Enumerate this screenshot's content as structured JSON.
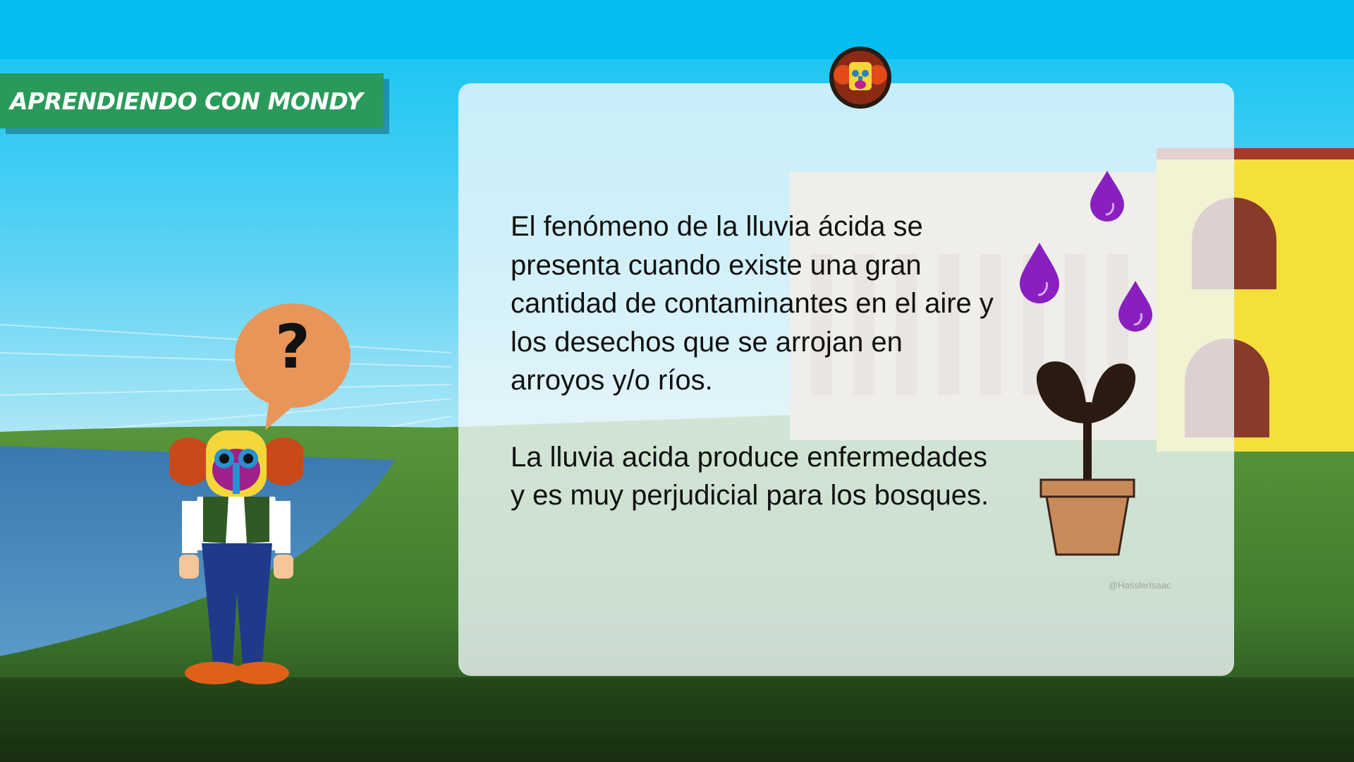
{
  "banner": {
    "title": "APRENDIENDO CON MONDY"
  },
  "card": {
    "paragraphs": [
      "El fenómeno de la lluvia ácida se presenta cuando existe una gran cantidad de contaminantes en el aire y los desechos que se arrojan en arroyos y/o ríos.",
      "La lluvia acida produce enfermedades y es muy perjudicial para los bosques."
    ],
    "watermark": "@HasslerIsaac"
  },
  "bubble": {
    "symbol": "?"
  },
  "icons": {
    "logo": "mondy-logo-icon",
    "raindrop": "raindrop-icon",
    "plant": "potted-sprout-icon",
    "character": "mondy-character"
  },
  "colors": {
    "banner": "#2a9a5a",
    "raindrop": "#8a1fc0",
    "bubble": "#e8955a",
    "pot": "#c98a5a",
    "sky": "#0fc4f0"
  }
}
